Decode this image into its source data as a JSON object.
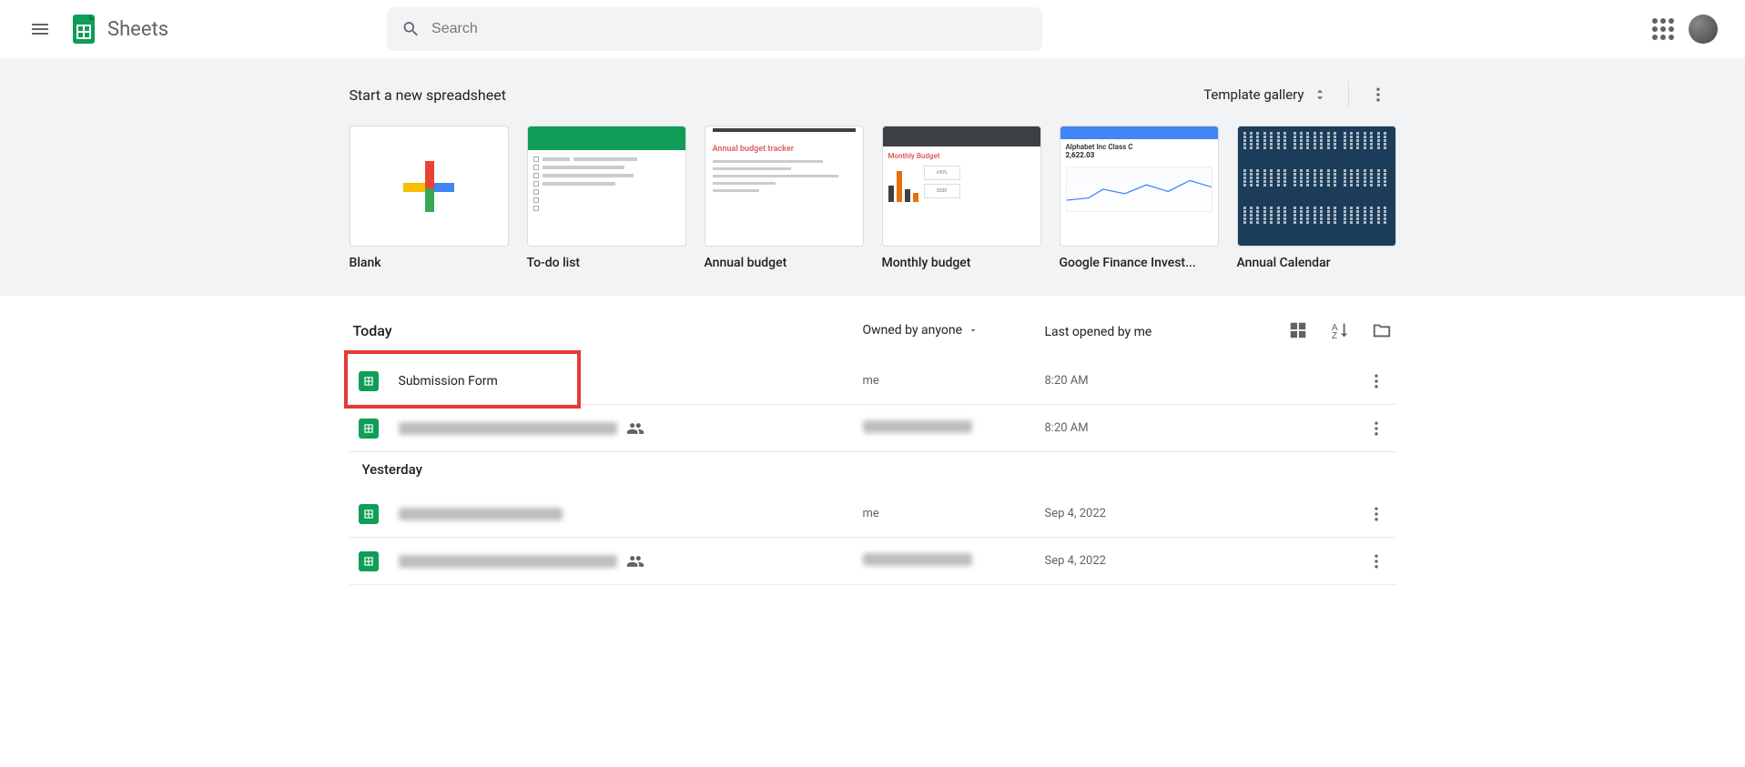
{
  "header": {
    "app_title": "Sheets",
    "search_placeholder": "Search"
  },
  "templates": {
    "heading": "Start a new spreadsheet",
    "gallery_button": "Template gallery",
    "items": [
      {
        "label": "Blank"
      },
      {
        "label": "To-do list"
      },
      {
        "label": "Annual budget"
      },
      {
        "label": "Monthly budget"
      },
      {
        "label": "Google Finance Invest..."
      },
      {
        "label": "Annual Calendar"
      }
    ],
    "thumb_text": {
      "annual_budget_title": "Annual budget tracker",
      "monthly_budget_title": "Monthly Budget",
      "finance_title": "Alphabet Inc Class C",
      "finance_value": "2,622.03"
    }
  },
  "list_header": {
    "owner_filter": "Owned by anyone",
    "sort_label": "Last opened by me"
  },
  "groups": [
    {
      "label": "Today",
      "files": [
        {
          "name": "Submission Form",
          "owner": "me",
          "date": "8:20 AM",
          "shared": false,
          "blurred": false,
          "highlighted": true
        },
        {
          "name": "",
          "owner": "",
          "date": "8:20 AM",
          "shared": true,
          "blurred": true,
          "highlighted": false
        }
      ]
    },
    {
      "label": "Yesterday",
      "files": [
        {
          "name": "",
          "owner": "me",
          "date": "Sep 4, 2022",
          "shared": false,
          "blurred": true,
          "highlighted": false
        },
        {
          "name": "",
          "owner": "",
          "date": "Sep 4, 2022",
          "shared": true,
          "blurred": true,
          "highlighted": false
        }
      ]
    }
  ]
}
